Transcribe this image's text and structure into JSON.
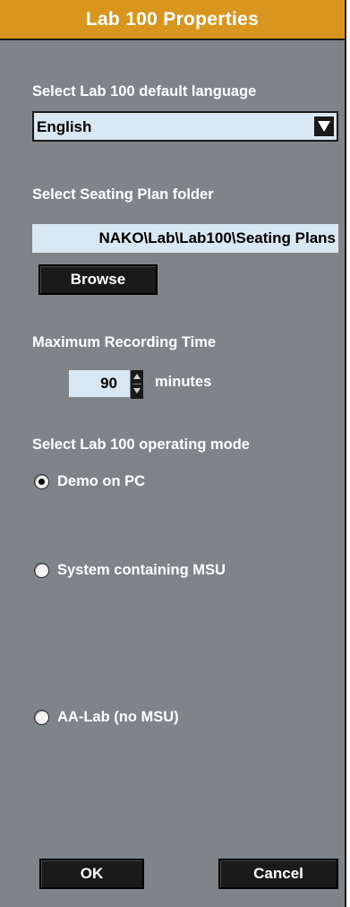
{
  "dialog": {
    "title": "Lab 100 Properties"
  },
  "language": {
    "label": "Select Lab 100 default language",
    "selected": "English",
    "arrow_icon": "chevron-down-icon"
  },
  "seating": {
    "label": "Select Seating Plan folder",
    "path": "NAKO\\Lab\\Lab100\\Seating Plans",
    "browse_label": "Browse"
  },
  "recording": {
    "label": "Maximum Recording Time",
    "value": "90",
    "unit": "minutes"
  },
  "mode": {
    "label": "Select Lab 100 operating mode",
    "options": [
      {
        "label": "Demo on PC",
        "checked": true
      },
      {
        "label": "System containing MSU",
        "checked": false
      },
      {
        "label": "AA-Lab (no MSU)",
        "checked": false
      }
    ]
  },
  "buttons": {
    "ok": "OK",
    "cancel": "Cancel"
  },
  "colors": {
    "title_bar": "#d9961f",
    "background": "#7f8489",
    "field": "#d9e7f2",
    "button": "#1a1a1a"
  }
}
